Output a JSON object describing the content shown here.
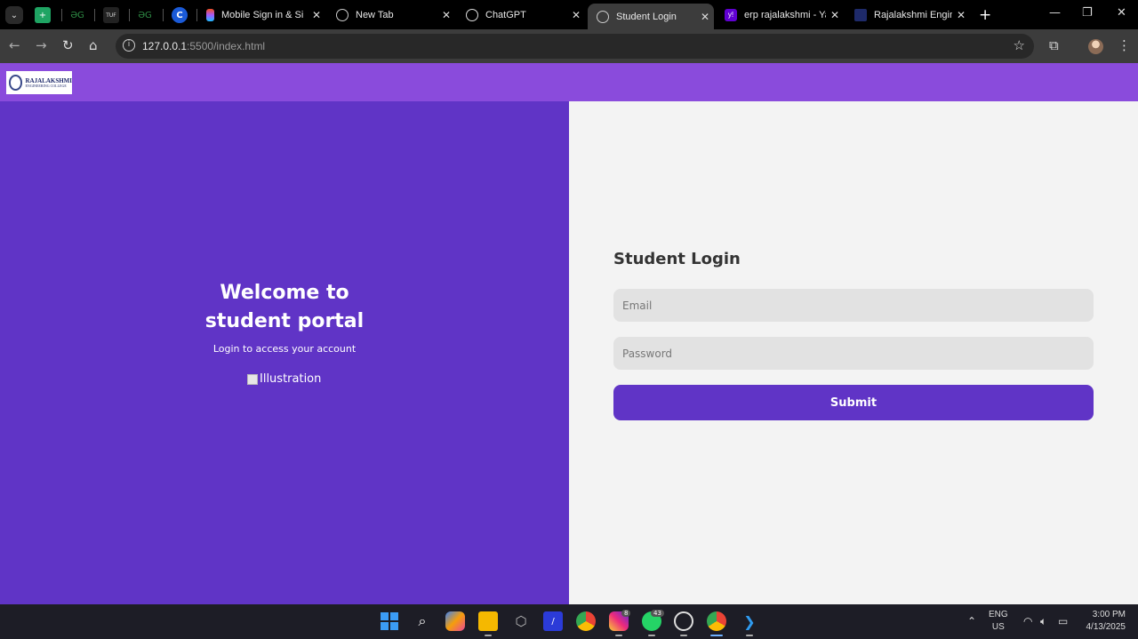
{
  "browser": {
    "tabs": [
      {
        "title": "Mobile Sign in & Si",
        "icon": "figma-icon"
      },
      {
        "title": "New Tab",
        "icon": "globe-icon"
      },
      {
        "title": "ChatGPT",
        "icon": "chatgpt-icon"
      },
      {
        "title": "Student Login",
        "icon": "globe-icon",
        "active": true
      },
      {
        "title": "erp rajalakshmi - Ya",
        "icon": "yahoo-icon"
      },
      {
        "title": "Rajalakshmi Engine",
        "icon": "rec-icon"
      }
    ],
    "url_host": "127.0.0.1",
    "url_path": ":5500/index.html"
  },
  "page": {
    "logo": {
      "line1": "RAJALAKSHMI",
      "line2": "ENGINEERING COLLEGE"
    },
    "welcome_line1": "Welcome to",
    "welcome_line2": "student portal",
    "subtext": "Login to access your account",
    "illustration_alt": "Illustration",
    "login_title": "Student Login",
    "email_placeholder": "Email",
    "password_placeholder": "Password",
    "submit_label": "Submit"
  },
  "taskbar": {
    "instagram_badge": "8",
    "whatsapp_badge": "43",
    "lang_line1": "ENG",
    "lang_line2": "US",
    "time": "3:00 PM",
    "date": "4/13/2025"
  },
  "colors": {
    "header_purple": "#8a4bdc",
    "panel_purple": "#6034c6",
    "button_purple": "#6034c6"
  }
}
